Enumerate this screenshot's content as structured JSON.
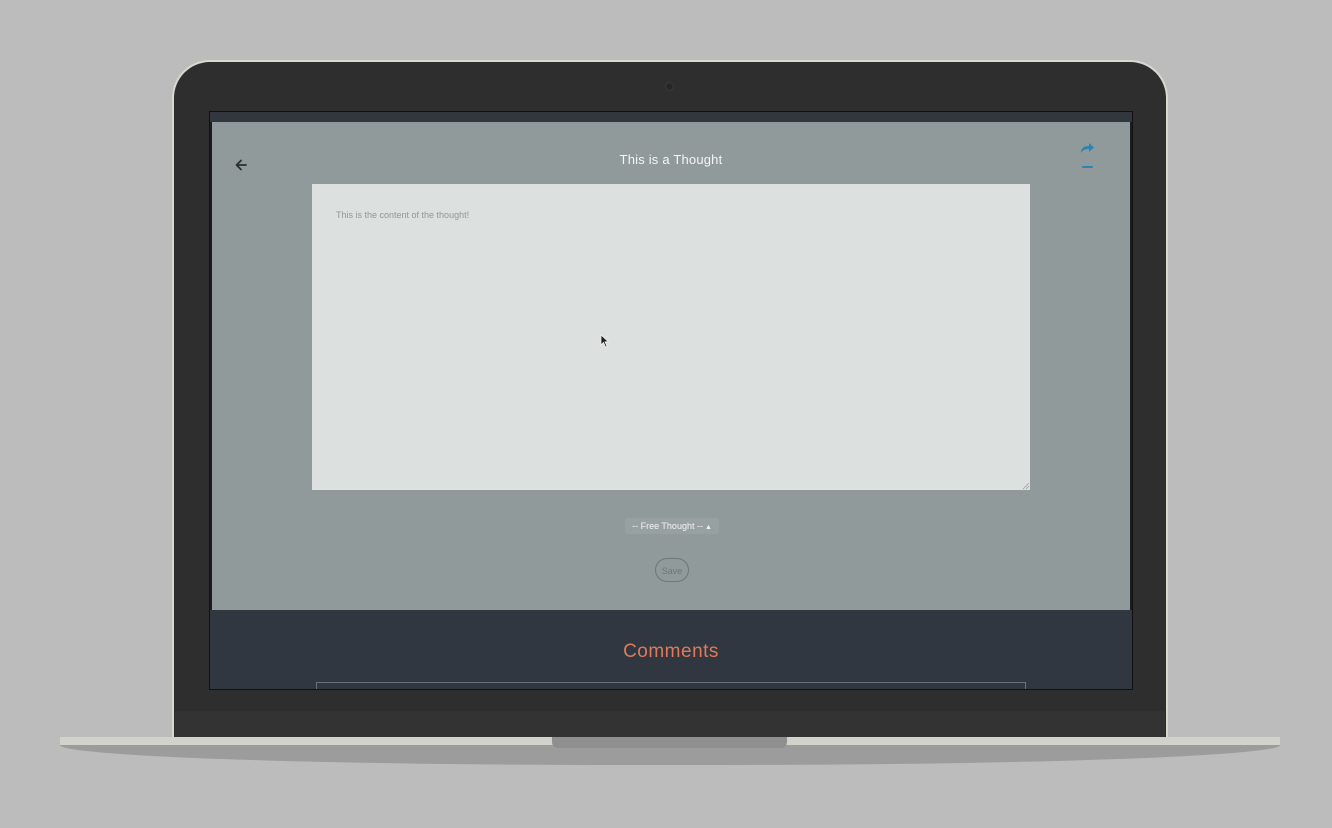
{
  "header": {
    "title": "This is a Thought"
  },
  "editor": {
    "content": "This is the content of the thought!"
  },
  "category_select": {
    "selected": "-- Free Thought --"
  },
  "actions": {
    "save_label": "Save"
  },
  "comments": {
    "title": "Comments"
  },
  "colors": {
    "page_bg": "#919a9b",
    "editor_bg": "#dce0df",
    "comments_bg": "#303740",
    "comments_title": "#e07a58",
    "accent_icon": "#2b84b3"
  },
  "icons": {
    "back": "arrow-left-icon",
    "share": "share-icon",
    "minimize": "minus-icon"
  }
}
